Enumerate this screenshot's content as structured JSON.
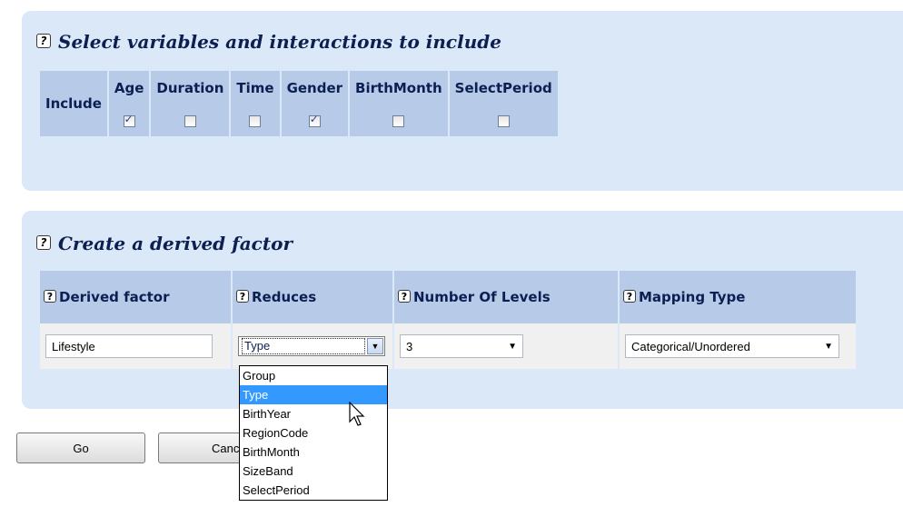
{
  "section1": {
    "help_icon": "?",
    "title": "Select variables and interactions to include",
    "row_header": "Include",
    "columns": [
      {
        "label": "Age",
        "checked": true
      },
      {
        "label": "Duration",
        "checked": false
      },
      {
        "label": "Time",
        "checked": false
      },
      {
        "label": "Gender",
        "checked": true
      },
      {
        "label": "BirthMonth",
        "checked": false
      },
      {
        "label": "SelectPeriod",
        "checked": false
      }
    ]
  },
  "section2": {
    "help_icon": "?",
    "title": "Create a derived factor",
    "headers": {
      "derived_factor": "Derived factor",
      "reduces": "Reduces",
      "number_of_levels": "Number Of Levels",
      "mapping_type": "Mapping Type"
    },
    "derived_factor_value": "Lifestyle",
    "reduces_value": "Type",
    "number_of_levels_value": "3",
    "mapping_type_value": "Categorical/Unordered",
    "reduces_options": [
      "Group",
      "Type",
      "BirthYear",
      "RegionCode",
      "BirthMonth",
      "SizeBand",
      "SelectPeriod"
    ],
    "reduces_highlighted": "Type"
  },
  "buttons": {
    "go": "Go",
    "cancel": "Cance"
  },
  "colors": {
    "panel_bg": "#dbe8f7",
    "header_bg": "#b7cbe8",
    "title_color": "#0b1f52",
    "selected_option": "#3399ff"
  }
}
